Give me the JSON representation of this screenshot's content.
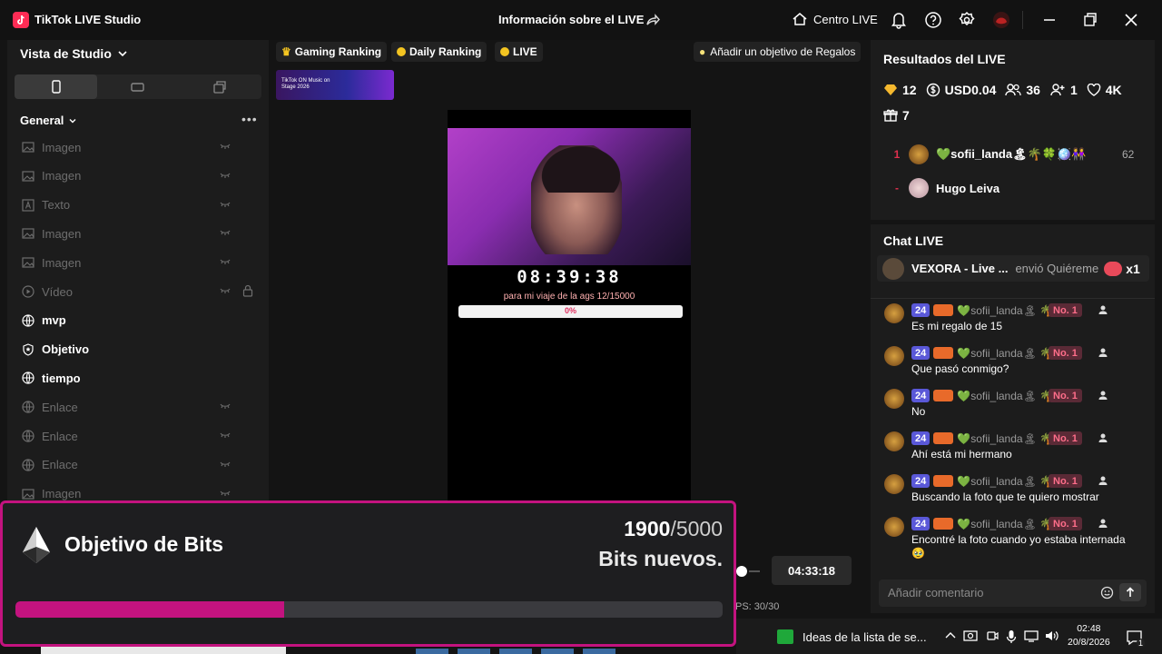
{
  "titlebar": {
    "app_name": "TikTok LIVE Studio",
    "center_title": "Información sobre el LIVE",
    "centro_live": "Centro LIVE"
  },
  "left_panel": {
    "header": "Vista de Studio",
    "section_title": "General",
    "sources": [
      {
        "label": "Imagen",
        "icon": "image-icon",
        "active": false
      },
      {
        "label": "Imagen",
        "icon": "image-icon",
        "active": false
      },
      {
        "label": "Texto",
        "icon": "text-icon",
        "active": false
      },
      {
        "label": "Imagen",
        "icon": "image-icon",
        "active": false
      },
      {
        "label": "Imagen",
        "icon": "image-icon",
        "active": false
      },
      {
        "label": "Vídeo",
        "icon": "video-icon",
        "active": false
      },
      {
        "label": "mvp",
        "icon": "globe-icon",
        "active": true
      },
      {
        "label": "Objetivo",
        "icon": "shield-icon",
        "active": true
      },
      {
        "label": "tiempo",
        "icon": "globe-icon",
        "active": true
      },
      {
        "label": "Enlace",
        "icon": "globe-icon",
        "active": false
      },
      {
        "label": "Enlace",
        "icon": "globe-icon",
        "active": false
      },
      {
        "label": "Enlace",
        "icon": "globe-icon",
        "active": false
      },
      {
        "label": "Imagen",
        "icon": "image-icon",
        "active": false
      }
    ]
  },
  "center": {
    "chips": [
      "Gaming Ranking",
      "Daily Ranking",
      "LIVE"
    ],
    "goal_button": "Añadir un objetivo de Regalos",
    "banner_text": "TikTok ON Music on Stage 2026",
    "preview": {
      "timer": "08:39:38",
      "goal_text": "para mi viaje de la ags  12/15000",
      "goal_percent_label": "0%"
    },
    "duration": "04:33:18",
    "fps": "PS: 30/30"
  },
  "results": {
    "title": "Resultados del LIVE",
    "stats": [
      {
        "icon": "diamond-icon",
        "value": "12"
      },
      {
        "icon": "dollar-icon",
        "value": "USD0.04"
      },
      {
        "icon": "viewers-icon",
        "value": "36"
      },
      {
        "icon": "new-followers-icon",
        "value": "1"
      },
      {
        "icon": "heart-icon",
        "value": "4K"
      },
      {
        "icon": "gift-icon",
        "value": "7"
      }
    ],
    "ranking": [
      {
        "rank": "1",
        "name": "💚sofii_landa🏝🌴🍀🪩⁠⁠⁠👭",
        "score": "62"
      },
      {
        "rank": "-",
        "name": "Hugo Leiva",
        "score": ""
      }
    ]
  },
  "chat": {
    "title": "Chat LIVE",
    "pinned": {
      "user": "VEXORA - Live ...",
      "action": "envió Quiéreme",
      "count": "x1"
    },
    "messages": [
      {
        "level": "24",
        "user": "💚sofii_landa🏝 🌴...",
        "rank": "No. 1",
        "text": "Es mi regalo de 15"
      },
      {
        "level": "24",
        "user": "💚sofii_landa🏝 🌴...",
        "rank": "No. 1",
        "text": "Que pasó conmigo?"
      },
      {
        "level": "24",
        "user": "💚sofii_landa🏝 🌴...",
        "rank": "No. 1",
        "text": "No"
      },
      {
        "level": "24",
        "user": "💚sofii_landa🏝 🌴...",
        "rank": "No. 1",
        "text": "Ahí está mi hermano"
      },
      {
        "level": "24",
        "user": "💚sofii_landa🏝 🌴...",
        "rank": "No. 1",
        "text": "Buscando la foto que te quiero mostrar"
      },
      {
        "level": "24",
        "user": "💚sofii_landa🏝 🌴...",
        "rank": "No. 1",
        "text": "Encontré la foto cuando yo estaba internada🥹"
      }
    ],
    "comment_placeholder": "Añadir comentario"
  },
  "bits_overlay": {
    "title": "Objetivo de Bits",
    "current": "1900",
    "separator": "/",
    "target": "5000",
    "subtitle": "Bits nuevos.",
    "progress_fraction": 0.38,
    "accent": "#c3137f"
  },
  "taskbar": {
    "app_label": "Ideas de la lista de se...",
    "time": "02:48",
    "date": "20/8/2026",
    "notifications": "1"
  },
  "colors": {
    "tiktok_red": "#fe2c55",
    "panel_bg": "#1c1c1c",
    "rank_red": "#e0304e",
    "level_badge": "#5a58d8"
  }
}
